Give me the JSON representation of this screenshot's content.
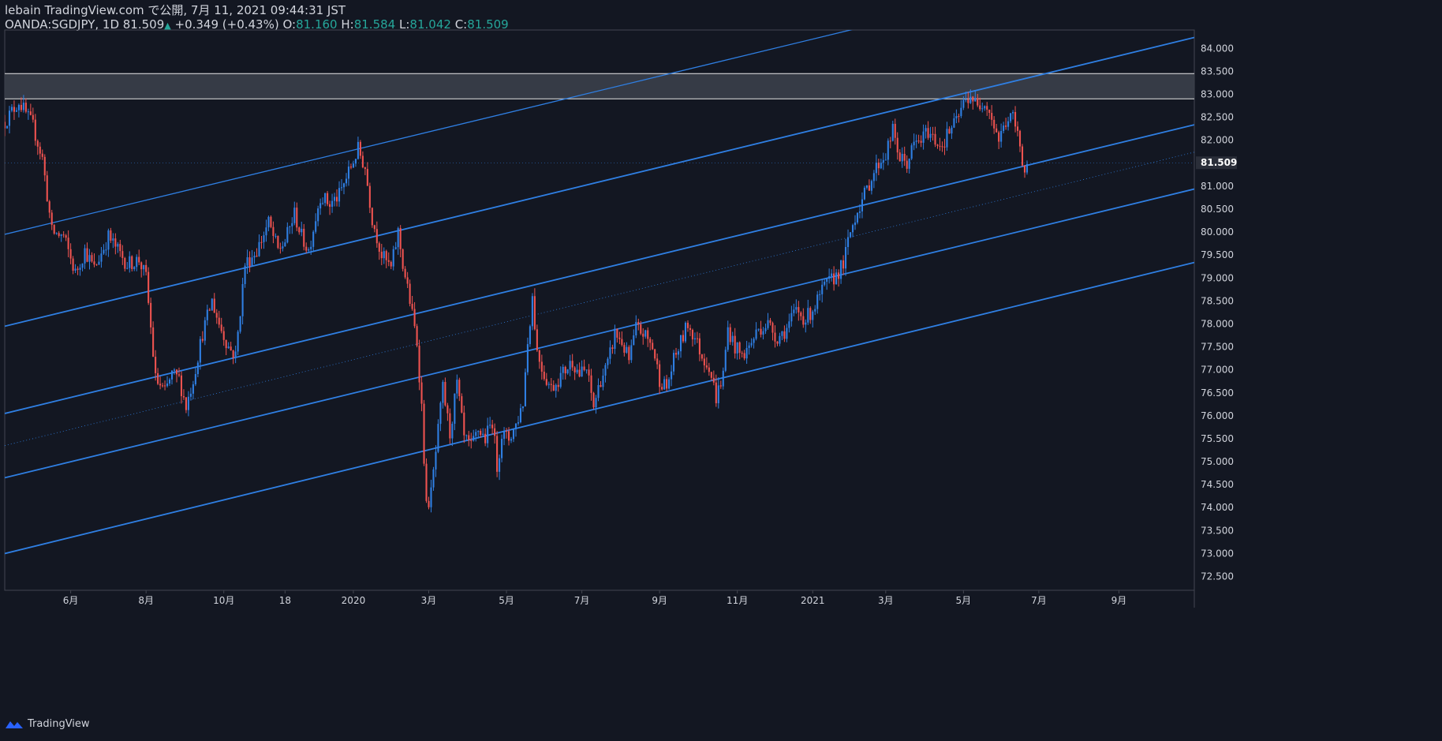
{
  "header": {
    "line1": "lebain TradingView.com で公開, 7月 11, 2021 09:44:31 JST",
    "symbol": "OANDA:SGDJPY, 1D 81.509",
    "change_arrow": "▲",
    "change": "+0.349 (+0.43%)",
    "o_label": "O:",
    "o": "81.160",
    "h_label": "H:",
    "h": "81.584",
    "l_label": "L:",
    "l": "81.042",
    "c_label": "C:",
    "c": "81.509"
  },
  "footer": {
    "brand": "TradingView",
    "icon": "tradingview-logo-icon"
  },
  "colors": {
    "background": "#131722",
    "up": "#2f7fe3",
    "down": "#ef5350",
    "channel": "#2f7fe3",
    "zone_fill": "#3b3f4a",
    "zone_border": "#e8e8e8",
    "axis_text": "#d1d4dc"
  },
  "chart_data": {
    "type": "candlestick",
    "ylim": [
      72.2,
      84.4
    ],
    "y_ticks": [
      "72.500",
      "73.000",
      "73.500",
      "74.000",
      "74.500",
      "75.000",
      "75.500",
      "76.000",
      "76.500",
      "77.000",
      "77.500",
      "78.000",
      "78.500",
      "79.000",
      "79.500",
      "80.000",
      "80.500",
      "81.000",
      "81.500",
      "82.000",
      "82.500",
      "83.000",
      "83.500",
      "84.000"
    ],
    "y_tick_values": [
      72.5,
      73,
      73.5,
      74,
      74.5,
      75,
      75.5,
      76,
      76.5,
      77,
      77.5,
      78,
      78.5,
      79,
      79.5,
      80,
      80.5,
      81,
      81.5,
      82,
      82.5,
      83,
      83.5,
      84
    ],
    "x_tick_labels": [
      "6月",
      "8月",
      "10月",
      "18",
      "2020",
      "3月",
      "5月",
      "7月",
      "9月",
      "11月",
      "2021",
      "3月",
      "5月",
      "7月",
      "9月"
    ],
    "x_tick_index": [
      28,
      60,
      93,
      119,
      148,
      180,
      213,
      245,
      278,
      311,
      343,
      374,
      407,
      439,
      473
    ],
    "x_domain": [
      0,
      505
    ],
    "last_price": "81.509",
    "last_value": 81.509,
    "resistance_zone": [
      82.9,
      83.45
    ],
    "price_path": [
      [
        0,
        82.4
      ],
      [
        6,
        82.85
      ],
      [
        12,
        82.3
      ],
      [
        16,
        81.6
      ],
      [
        20,
        80.0
      ],
      [
        25,
        79.9
      ],
      [
        30,
        79.1
      ],
      [
        34,
        79.6
      ],
      [
        38,
        79.2
      ],
      [
        44,
        79.9
      ],
      [
        48,
        79.6
      ],
      [
        52,
        79.3
      ],
      [
        57,
        79.4
      ],
      [
        60,
        79.0
      ],
      [
        64,
        76.8
      ],
      [
        68,
        76.5
      ],
      [
        71,
        76.9
      ],
      [
        74,
        76.8
      ],
      [
        77,
        76.2
      ],
      [
        80,
        76.8
      ],
      [
        84,
        77.8
      ],
      [
        88,
        78.5
      ],
      [
        91,
        78.0
      ],
      [
        95,
        77.5
      ],
      [
        98,
        77.3
      ],
      [
        102,
        79.3
      ],
      [
        107,
        79.6
      ],
      [
        112,
        80.2
      ],
      [
        116,
        79.6
      ],
      [
        119,
        79.8
      ],
      [
        123,
        80.4
      ],
      [
        126,
        79.9
      ],
      [
        129,
        79.6
      ],
      [
        134,
        80.8
      ],
      [
        138,
        80.6
      ],
      [
        142,
        80.8
      ],
      [
        146,
        81.3
      ],
      [
        150,
        81.8
      ],
      [
        153,
        81.4
      ],
      [
        156,
        80.3
      ],
      [
        160,
        79.5
      ],
      [
        164,
        79.2
      ],
      [
        167,
        80.0
      ],
      [
        169,
        79.3
      ],
      [
        172,
        78.5
      ],
      [
        175,
        77.6
      ],
      [
        177,
        76.2
      ],
      [
        179,
        74.0
      ],
      [
        181,
        74.3
      ],
      [
        183,
        75.2
      ],
      [
        186,
        76.6
      ],
      [
        189,
        75.6
      ],
      [
        192,
        76.7
      ],
      [
        195,
        75.5
      ],
      [
        198,
        75.3
      ],
      [
        201,
        75.7
      ],
      [
        204,
        75.5
      ],
      [
        207,
        75.9
      ],
      [
        209,
        74.9
      ],
      [
        211,
        75.6
      ],
      [
        214,
        75.5
      ],
      [
        217,
        75.8
      ],
      [
        220,
        76.3
      ],
      [
        222,
        77.6
      ],
      [
        224,
        78.6
      ],
      [
        226,
        77.4
      ],
      [
        229,
        76.9
      ],
      [
        232,
        76.6
      ],
      [
        235,
        76.8
      ],
      [
        238,
        77.0
      ],
      [
        241,
        77.2
      ],
      [
        244,
        76.9
      ],
      [
        247,
        77.0
      ],
      [
        250,
        76.2
      ],
      [
        253,
        76.8
      ],
      [
        256,
        77.1
      ],
      [
        259,
        77.8
      ],
      [
        262,
        77.6
      ],
      [
        265,
        77.2
      ],
      [
        268,
        77.9
      ],
      [
        271,
        77.8
      ],
      [
        275,
        77.5
      ],
      [
        278,
        76.8
      ],
      [
        281,
        76.6
      ],
      [
        284,
        77.2
      ],
      [
        287,
        77.6
      ],
      [
        290,
        78.0
      ],
      [
        293,
        77.7
      ],
      [
        296,
        77.3
      ],
      [
        299,
        77.1
      ],
      [
        302,
        76.4
      ],
      [
        305,
        76.9
      ],
      [
        307,
        77.9
      ],
      [
        310,
        77.5
      ],
      [
        313,
        77.3
      ],
      [
        316,
        77.5
      ],
      [
        320,
        77.9
      ],
      [
        324,
        78.0
      ],
      [
        328,
        77.7
      ],
      [
        332,
        77.9
      ],
      [
        336,
        78.3
      ],
      [
        340,
        78.1
      ],
      [
        344,
        78.4
      ],
      [
        348,
        78.8
      ],
      [
        352,
        79.0
      ],
      [
        356,
        79.3
      ],
      [
        359,
        80.0
      ],
      [
        362,
        80.5
      ],
      [
        365,
        80.8
      ],
      [
        368,
        81.2
      ],
      [
        371,
        81.5
      ],
      [
        374,
        81.7
      ],
      [
        377,
        82.2
      ],
      [
        380,
        81.6
      ],
      [
        383,
        81.5
      ],
      [
        386,
        81.9
      ],
      [
        389,
        82.0
      ],
      [
        392,
        82.2
      ],
      [
        395,
        82.0
      ],
      [
        398,
        81.9
      ],
      [
        401,
        82.2
      ],
      [
        404,
        82.4
      ],
      [
        407,
        82.8
      ],
      [
        410,
        83.0
      ],
      [
        413,
        82.7
      ],
      [
        416,
        82.9
      ],
      [
        419,
        82.5
      ],
      [
        422,
        82.0
      ],
      [
        425,
        82.4
      ],
      [
        428,
        82.5
      ],
      [
        431,
        81.9
      ],
      [
        433,
        81.3
      ],
      [
        434,
        81.51
      ]
    ],
    "channel_lines": [
      {
        "points": [
          [
            0,
            79.95
          ],
          [
            355,
            84.35
          ]
        ],
        "style": "solid"
      },
      {
        "points": [
          [
            0,
            77.95
          ],
          [
            490,
            84.05
          ]
        ],
        "style": "solid"
      },
      {
        "points": [
          [
            0,
            76.05
          ],
          [
            490,
            82.15
          ]
        ],
        "style": "solid"
      },
      {
        "points": [
          [
            0,
            75.35
          ],
          [
            490,
            81.55
          ]
        ],
        "style": "dotted"
      },
      {
        "points": [
          [
            0,
            74.65
          ],
          [
            490,
            80.75
          ]
        ],
        "style": "solid"
      },
      {
        "points": [
          [
            0,
            73.0
          ],
          [
            490,
            79.15
          ]
        ],
        "style": "solid"
      }
    ]
  }
}
